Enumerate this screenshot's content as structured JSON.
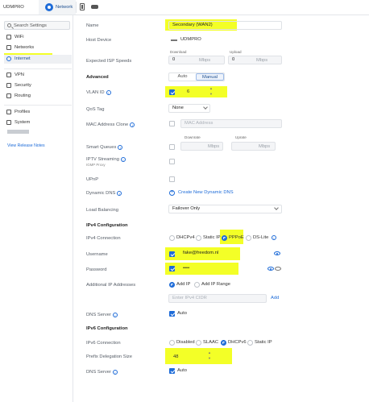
{
  "topbar": {
    "device_name": "UDMPRO",
    "active_app": "Network"
  },
  "sidebar": {
    "search_placeholder": "Search Settings",
    "items": [
      {
        "label": "WiFi",
        "icon": "wifi-icon"
      },
      {
        "label": "Networks",
        "icon": "networks-icon"
      },
      {
        "label": "Internet",
        "icon": "globe-icon",
        "active": true
      },
      {
        "label": "VPN",
        "icon": "vpn-icon"
      },
      {
        "label": "Security",
        "icon": "shield-icon"
      },
      {
        "label": "Routing",
        "icon": "routing-icon"
      },
      {
        "label": "Profiles",
        "icon": "profiles-icon"
      },
      {
        "label": "System",
        "icon": "system-icon"
      }
    ],
    "release_notes": "View Release Notes"
  },
  "form": {
    "name": {
      "label": "Name",
      "value": "Secondary (WAN2)"
    },
    "host_device": {
      "label": "Host Device",
      "value": "UDMPRO"
    },
    "isp_speeds": {
      "label": "Expected ISP Speeds",
      "download_label": "Download",
      "download_value": "0",
      "download_unit": "Mbps",
      "upload_label": "Upload",
      "upload_value": "0",
      "upload_unit": "Mbps"
    },
    "advanced": {
      "label": "Advanced",
      "options": [
        "Auto",
        "Manual"
      ],
      "selected": "Manual"
    },
    "vlan_id": {
      "label": "VLAN ID",
      "checked": true,
      "value": "6"
    },
    "qos_tag": {
      "label": "QoS Tag",
      "value": "None"
    },
    "mac_clone": {
      "label": "MAC Address Clone",
      "checked": false,
      "placeholder": "MAC Address"
    },
    "smart_queues": {
      "label": "Smart Queues",
      "checked": false,
      "downrate_label": "Downrate",
      "downrate_unit": "Mbps",
      "uprate_label": "Uprate",
      "uprate_unit": "Mbps"
    },
    "iptv": {
      "label": "IPTV Streaming",
      "sublabel": "IGMP Proxy",
      "checked": false
    },
    "upnp": {
      "label": "UPnP",
      "checked": false
    },
    "dynamic_dns": {
      "label": "Dynamic DNS",
      "action": "Create New Dynamic DNS"
    },
    "load_balancing": {
      "label": "Load Balancing",
      "value": "Failover Only"
    },
    "ipv4": {
      "heading": "IPv4 Configuration",
      "connection_label": "IPv4 Connection",
      "connection_options": [
        "DHCPv4",
        "Static IP",
        "PPPoE",
        "DS-Lite"
      ],
      "connection_selected": "PPPoE",
      "username_label": "Username",
      "username_checked": true,
      "username_value": "fake@freedom.nl",
      "password_label": "Password",
      "password_checked": true,
      "password_value": "••••",
      "additional_ip_label": "Additional IP Addresses",
      "additional_ip_options": [
        "Add IP",
        "Add IP Range"
      ],
      "additional_ip_selected": "Add IP",
      "ipv4_cidr_placeholder": "Enter IPv4 CIDR",
      "add_label": "Add",
      "dns_label": "DNS Server",
      "dns_checked": true,
      "dns_value": "Auto"
    },
    "ipv6": {
      "heading": "IPv6 Configuration",
      "connection_label": "IPv6 Connection",
      "connection_options": [
        "Disabled",
        "SLAAC",
        "DHCPv6",
        "Static IP"
      ],
      "connection_selected": "DHCPv6",
      "prefix_label": "Prefix Delegation Size",
      "prefix_value": "48",
      "dns_label": "DNS Server",
      "dns_checked": true,
      "dns_value": "Auto"
    }
  },
  "colors": {
    "accent": "#1d6bd8",
    "highlight": "#f3ff27"
  }
}
